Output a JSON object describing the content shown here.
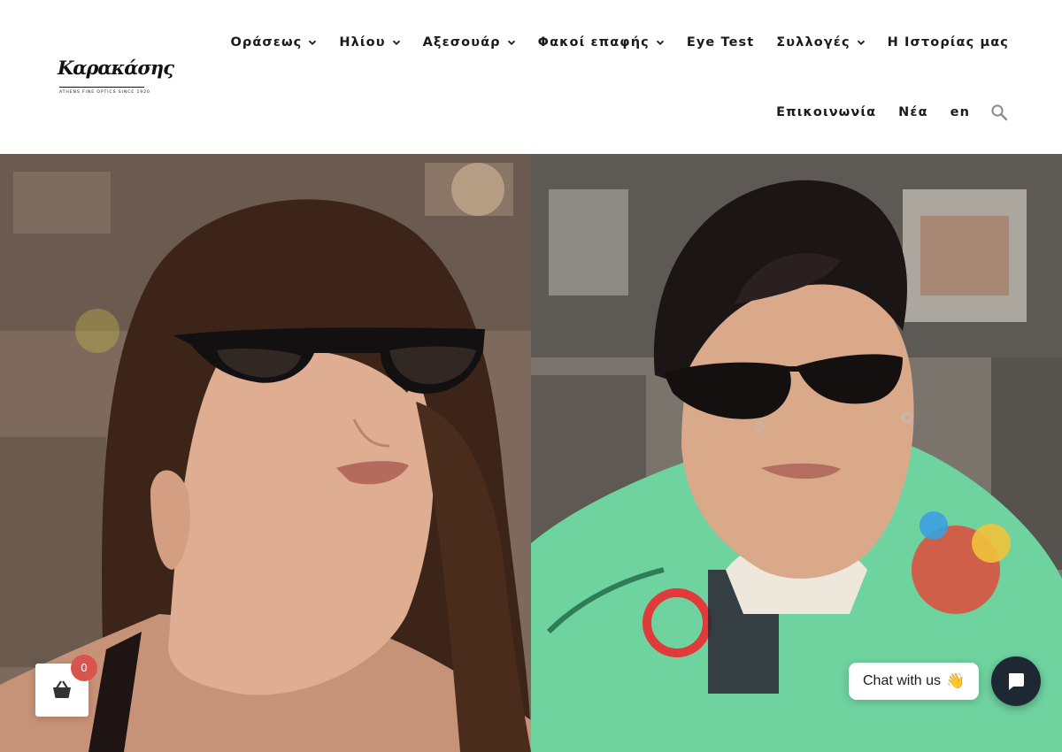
{
  "brand": {
    "name": "Καρακάσης",
    "tagline": "ATHENS FINE OPTICS SINCE 1920"
  },
  "nav": {
    "row1": [
      {
        "label": "Οράσεως",
        "dropdown": true
      },
      {
        "label": "Ηλίου",
        "dropdown": true
      },
      {
        "label": "Αξεσουάρ",
        "dropdown": true
      },
      {
        "label": "Φακοί επαφής",
        "dropdown": true
      },
      {
        "label": "Eye Test",
        "dropdown": false
      },
      {
        "label": "Συλλογές",
        "dropdown": true
      },
      {
        "label": "Η Ιστορίας μας",
        "dropdown": false
      }
    ],
    "row2": [
      {
        "label": "Επικοινωνία",
        "dropdown": false
      },
      {
        "label": "Νέα",
        "dropdown": false
      },
      {
        "label": "en",
        "dropdown": false
      }
    ],
    "search_icon": "search-icon"
  },
  "cart": {
    "count": "0",
    "icon": "basket-icon",
    "badge_color": "#d9534f"
  },
  "chat": {
    "label": "Chat with us",
    "emoji": "👋",
    "icon": "chat-icon",
    "launcher_color": "#1d2833"
  }
}
